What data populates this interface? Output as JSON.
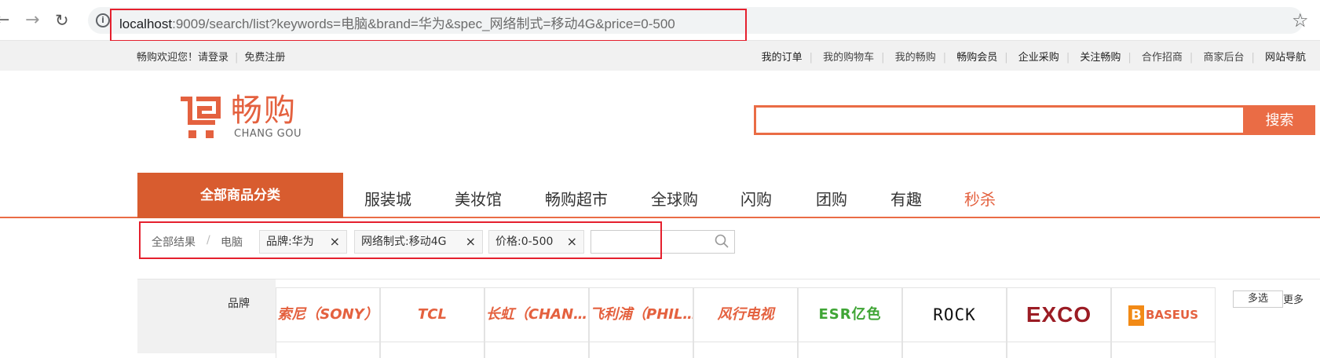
{
  "browser": {
    "url_host": "localhost",
    "url_path": ":9009/search/list?keywords=电脑&brand=华为&spec_网络制式=移动4G&price=0-500"
  },
  "shortcut": {
    "welcome": "畅购欢迎您！",
    "login": "请登录",
    "register": "免费注册",
    "links": [
      "我的订单",
      "我的购物车",
      "我的畅购",
      "畅购会员",
      "企业采购",
      "关注畅购",
      "合作招商",
      "商家后台",
      "网站导航"
    ]
  },
  "header": {
    "logo_cn": "畅购",
    "logo_en": "CHANG GOU",
    "search_value": "",
    "search_button": "搜索"
  },
  "nav": {
    "all_categories": "全部商品分类",
    "items": [
      "服装城",
      "美妆馆",
      "畅购超市",
      "全球购",
      "闪购",
      "团购",
      "有趣",
      "秒杀"
    ]
  },
  "crumb": {
    "all": "全部结果",
    "slash": "/",
    "current": "电脑",
    "tags": [
      "品牌:华为",
      "网络制式:移动4G",
      "价格:0-500"
    ],
    "tag_close": "×"
  },
  "brand_filter": {
    "label": "品牌",
    "brands": [
      "索尼（SONY）",
      "TCL",
      "长虹（CHAN…",
      "飞利浦（PHIL…",
      "风行电视",
      "ESR亿色",
      "ROCK",
      "EXCO",
      "BASEUS"
    ],
    "multi": "多选",
    "more": "更多"
  },
  "colors": {
    "accent": "#ea6c45",
    "category_bg": "#d85c2f",
    "highlight_box": "#e5202e"
  }
}
